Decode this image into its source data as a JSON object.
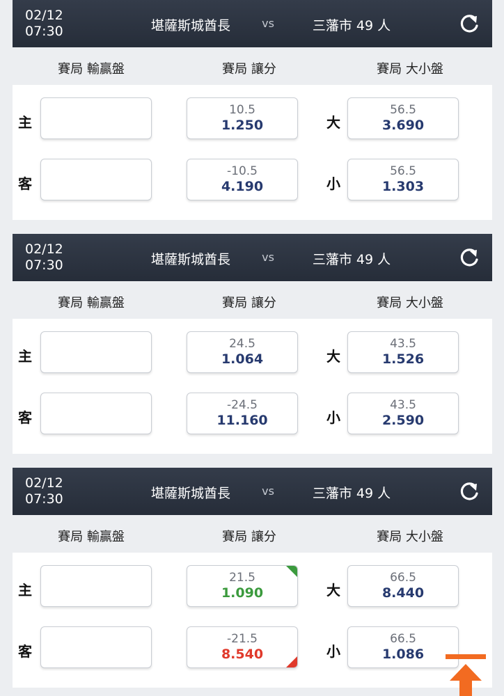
{
  "col_heads": {
    "moneyline": "賽局 輸贏盤",
    "spread": "賽局 讓分",
    "total": "賽局 大小盤"
  },
  "row_labels": {
    "home": "主",
    "away": "客",
    "over": "大",
    "under": "小"
  },
  "matches": [
    {
      "date": "02/12",
      "time": "07:30",
      "home_team": "堪薩斯城酋長",
      "vs": "vs",
      "away_team": "三藩市 49 人",
      "spread_home": {
        "line": "10.5",
        "odds": "1.250"
      },
      "spread_away": {
        "line": "-10.5",
        "odds": "4.190"
      },
      "total_over": {
        "line": "56.5",
        "odds": "3.690"
      },
      "total_under": {
        "line": "56.5",
        "odds": "1.303"
      }
    },
    {
      "date": "02/12",
      "time": "07:30",
      "home_team": "堪薩斯城酋長",
      "vs": "vs",
      "away_team": "三藩市 49 人",
      "spread_home": {
        "line": "24.5",
        "odds": "1.064"
      },
      "spread_away": {
        "line": "-24.5",
        "odds": "11.160"
      },
      "total_over": {
        "line": "43.5",
        "odds": "1.526"
      },
      "total_under": {
        "line": "43.5",
        "odds": "2.590"
      }
    },
    {
      "date": "02/12",
      "time": "07:30",
      "home_team": "堪薩斯城酋長",
      "vs": "vs",
      "away_team": "三藩市 49 人",
      "spread_home": {
        "line": "21.5",
        "odds": "1.090",
        "trend": "up"
      },
      "spread_away": {
        "line": "-21.5",
        "odds": "8.540",
        "trend": "down"
      },
      "total_over": {
        "line": "66.5",
        "odds": "8.440"
      },
      "total_under": {
        "line": "66.5",
        "odds": "1.086"
      }
    }
  ],
  "colors": {
    "header": "#2b3240",
    "odds": "#273a6f",
    "up": "#3b9a3d",
    "down": "#e0392b",
    "scroll_top": "#f26b21"
  },
  "icons": {
    "refresh": "refresh-icon",
    "scroll_top": "scroll-top-icon"
  }
}
